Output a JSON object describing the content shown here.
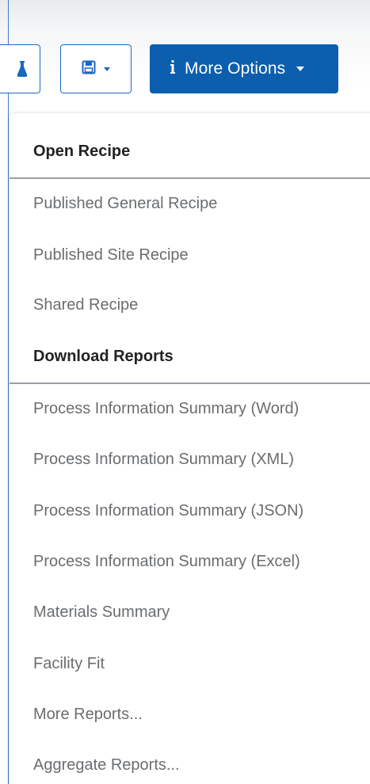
{
  "toolbar": {
    "flask_icon": "flask-icon",
    "save_icon": "floppy-disk-icon",
    "more_icon": "info-icon",
    "more_label": "More Options"
  },
  "menu": {
    "section1_header": "Open Recipe",
    "section1_items": [
      "Published General Recipe",
      "Published Site Recipe",
      "Shared Recipe"
    ],
    "section2_header": "Download Reports",
    "section2_items": [
      "Process Information Summary (Word)",
      "Process Information Summary (XML)",
      "Process Information Summary (JSON)",
      "Process Information Summary (Excel)",
      "Materials Summary",
      "Facility Fit",
      "More Reports...",
      "Aggregate Reports..."
    ]
  },
  "colors": {
    "primary": "#0b5fae",
    "outline": "#1a67c1",
    "header_text": "#222222",
    "item_text": "#6a6d70",
    "divider": "#9a9ea3"
  }
}
